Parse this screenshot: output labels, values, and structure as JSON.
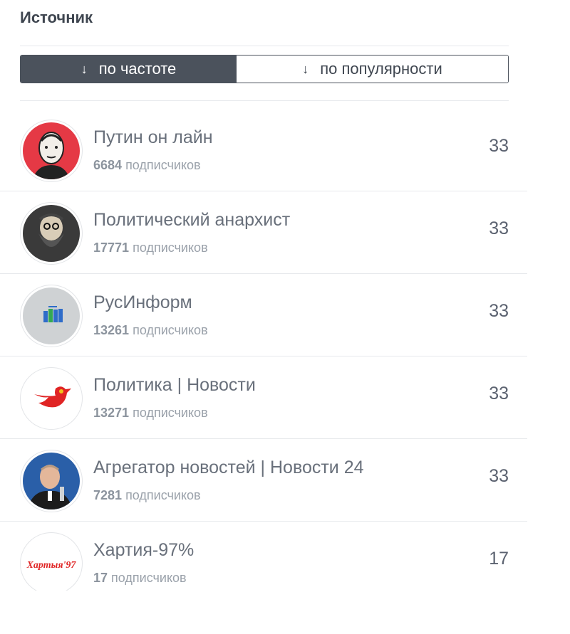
{
  "header": {
    "title": "Источник"
  },
  "sort": {
    "arrow_glyph": "↓",
    "options": [
      {
        "label": "по частоте",
        "active": true
      },
      {
        "label": "по популярности",
        "active": false
      }
    ]
  },
  "sources": [
    {
      "name": "Путин он лайн",
      "subscribers": "6684",
      "subscribers_label": "подписчиков",
      "count": "33",
      "avatar_icon": "putin-portrait-icon",
      "avatar_bg": "#e53945"
    },
    {
      "name": "Политический анархист",
      "subscribers": "17771",
      "subscribers_label": "подписчиков",
      "count": "33",
      "avatar_icon": "bearded-man-portrait-icon",
      "avatar_bg": "#3a3a3a"
    },
    {
      "name": "РусИнформ",
      "subscribers": "13261",
      "subscribers_label": "подписчиков",
      "count": "33",
      "avatar_icon": "rusinform-logo-icon",
      "avatar_bg": "#cfd2d4"
    },
    {
      "name": "Политика | Новости",
      "subscribers": "13271",
      "subscribers_label": "подписчиков",
      "count": "33",
      "avatar_icon": "red-bird-hammer-sickle-icon",
      "avatar_bg": "#ffffff"
    },
    {
      "name": "Агрегатор новостей | Новости 24",
      "subscribers": "7281",
      "subscribers_label": "подписчиков",
      "count": "33",
      "avatar_icon": "putin-photo-icon",
      "avatar_bg": "#2a5fa8"
    },
    {
      "name": "Хартия-97%",
      "subscribers": "17",
      "subscribers_label": "подписчиков",
      "count": "17",
      "avatar_icon": "charter97-logo-icon",
      "avatar_bg": "#ffffff",
      "logo_text": "Хартыя'97"
    }
  ]
}
